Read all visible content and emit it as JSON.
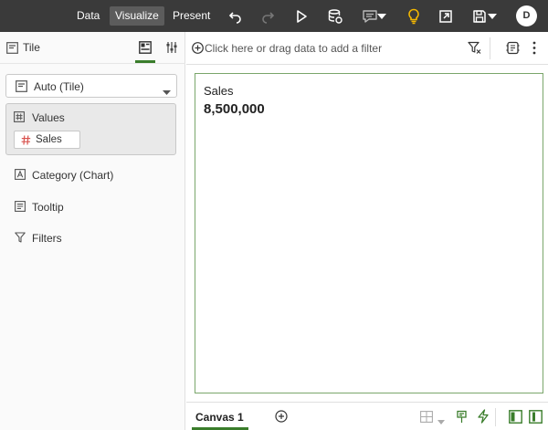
{
  "topbar": {
    "nav": [
      "Data",
      "Visualize",
      "Present"
    ],
    "active_nav": "Visualize",
    "avatar_initial": "D"
  },
  "left_panel": {
    "title": "Tile",
    "viz_type": "Auto (Tile)",
    "values_label": "Values",
    "values_chip": "Sales",
    "sections": [
      "Category (Chart)",
      "Tooltip",
      "Filters"
    ]
  },
  "filterbar": {
    "placeholder": "Click here or drag data to add a filter"
  },
  "tile": {
    "title": "Sales",
    "value": "8,500,000"
  },
  "bottombar": {
    "canvas_tab": "Canvas 1"
  },
  "colors": {
    "accent_green": "#3a7d2b",
    "topbar_bg": "#3a3a3a",
    "tile_border": "#7aa66b"
  }
}
